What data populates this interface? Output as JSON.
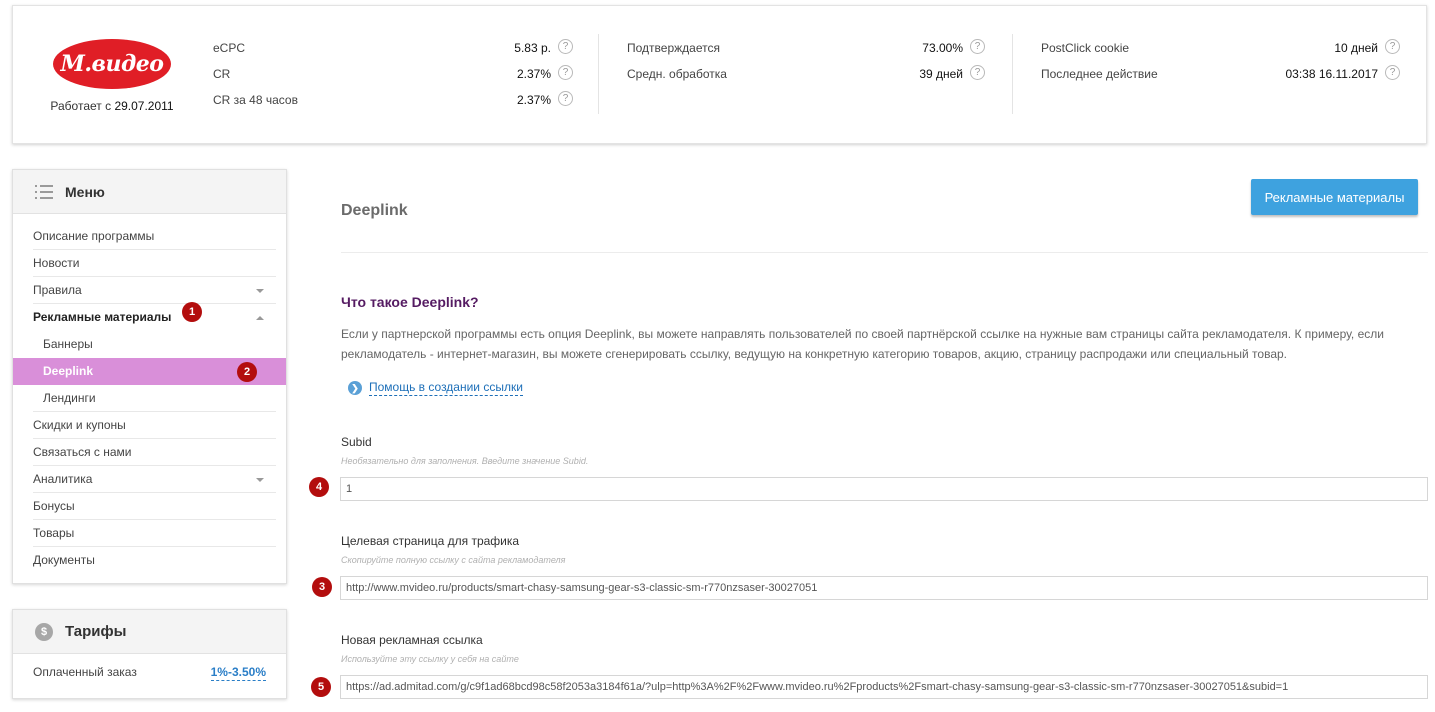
{
  "merchant": {
    "logo_text": "М.видео",
    "since_label": "Работает с",
    "since_date": "29.07.2011"
  },
  "stats": {
    "col1": [
      {
        "label": "eCPC",
        "value": "5.83 р."
      },
      {
        "label": "CR",
        "value": "2.37%"
      },
      {
        "label": "CR за 48 часов",
        "value": "2.37%"
      }
    ],
    "col2": [
      {
        "label": "Подтверждается",
        "value": "73.00%"
      },
      {
        "label": "Средн. обработка",
        "value": "39 дней"
      }
    ],
    "col3": [
      {
        "label": "PostClick cookie",
        "value": "10 дней"
      },
      {
        "label": "Последнее действие",
        "value": "03:38 16.11.2017"
      }
    ],
    "help_glyph": "?"
  },
  "menu": {
    "title": "Меню",
    "items": [
      {
        "label": "Описание программы"
      },
      {
        "label": "Новости"
      },
      {
        "label": "Правила"
      },
      {
        "label": "Рекламные материалы"
      },
      {
        "label": "Баннеры"
      },
      {
        "label": "Deeplink"
      },
      {
        "label": "Лендинги"
      },
      {
        "label": "Скидки и купоны"
      },
      {
        "label": "Связаться с нами"
      },
      {
        "label": "Аналитика"
      },
      {
        "label": "Бонусы"
      },
      {
        "label": "Товары"
      },
      {
        "label": "Документы"
      }
    ]
  },
  "tariffs": {
    "title": "Тарифы",
    "coin_glyph": "$",
    "row_label": "Оплаченный заказ",
    "row_value": "1%-3.50%"
  },
  "main": {
    "title": "Deeplink",
    "promo_button": "Рекламные материалы",
    "section_title": "Что такое Deeplink?",
    "section_desc": "Если у партнерской программы есть опция Deeplink, вы можете направлять пользователей по своей партнёрской ссылке на нужные вам страницы сайта рекламодателя. К примеру, если рекламодатель - интернет-магазин, вы можете сгенерировать ссылку, ведущую на конкретную категорию товаров, акцию, страницу распродажи или специальный товар.",
    "help_link": "Помощь в создании ссылки",
    "fields": {
      "subid": {
        "label": "Subid",
        "hint": "Необязательно для заполнения. Введите значение Subid.",
        "value": "1"
      },
      "target": {
        "label": "Целевая страница для трафика",
        "hint": "Скопируйте полную ссылку с сайта рекламодателя",
        "value": "http://www.mvideo.ru/products/smart-chasy-samsung-gear-s3-classic-sm-r770nzsaser-30027051"
      },
      "result": {
        "label": "Новая рекламная ссылка",
        "hint": "Используйте эту ссылку у себя на сайте",
        "value": "https://ad.admitad.com/g/c9f1ad68bcd98c58f2053a3184f61a/?ulp=http%3A%2F%2Fwww.mvideo.ru%2Fproducts%2Fsmart-chasy-samsung-gear-s3-classic-sm-r770nzsaser-30027051&subid=1"
      }
    }
  },
  "annotations": [
    "1",
    "2",
    "3",
    "4",
    "5"
  ],
  "colors": {
    "brand_red": "#e01e26",
    "active_menu": "#d98fd9",
    "button_blue": "#3ea2df",
    "section_title": "#551b62",
    "badge": "#b30d0d",
    "link": "#1d6fb8"
  }
}
